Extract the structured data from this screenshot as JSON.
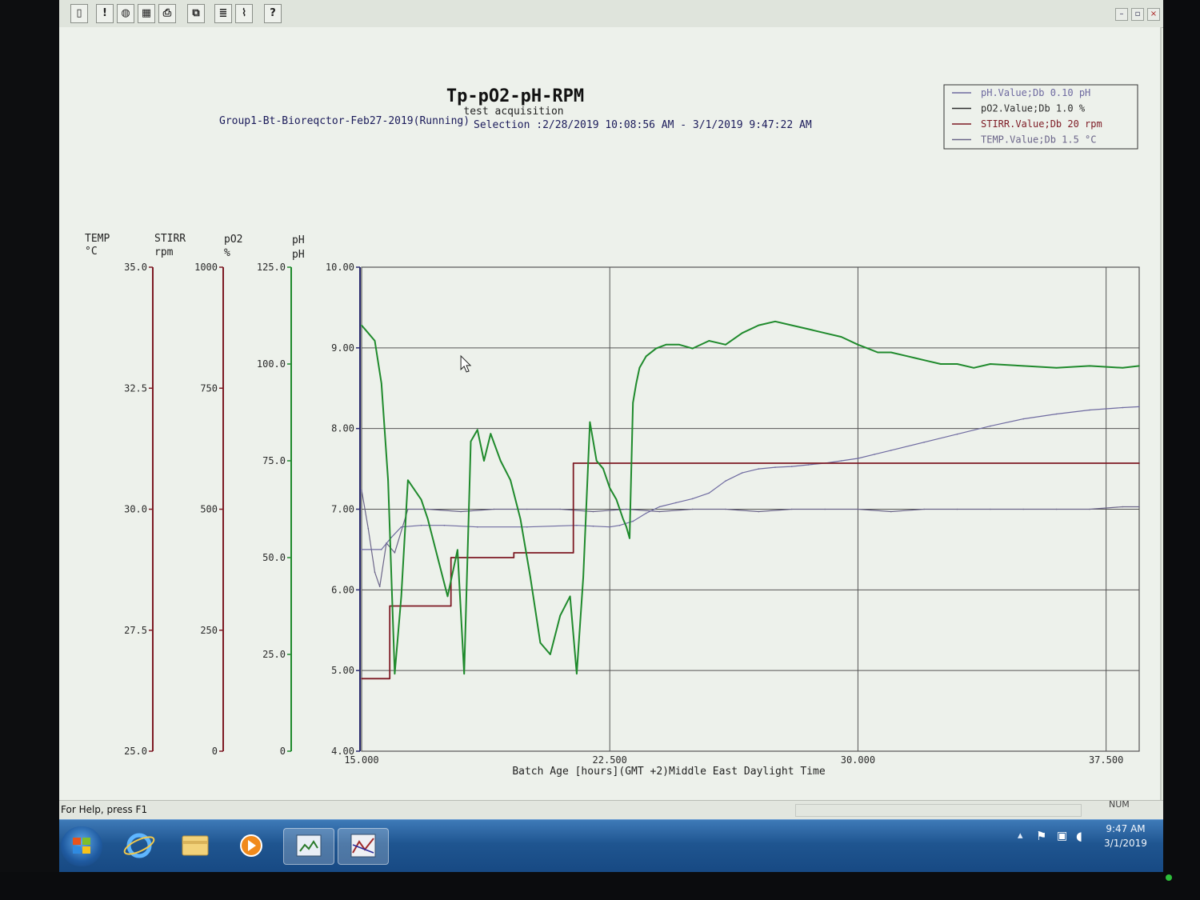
{
  "toolbar": {
    "buttons": [
      "new-document-icon",
      "alert-icon",
      "globe-icon",
      "grid-icon",
      "print-icon",
      "copy-icon",
      "list-icon",
      "trend-icon",
      "help-icon"
    ],
    "help_label": "?"
  },
  "window_controls": {
    "minimize": "–",
    "maximize": "▫",
    "close": "×"
  },
  "chart": {
    "title": "Tp-pO2-pH-RPM",
    "subtitle": "test acquisition",
    "source": "Group1-Bt-Bioreqctor-Feb27-2019(Running)",
    "selection": "Selection :2/28/2019 10:08:56 AM - 3/1/2019 9:47:22 AM",
    "xlabel": "Batch Age [hours](GMT +2)Middle East Daylight Time"
  },
  "legend": [
    {
      "label": "pH.Value;Db 0.10 pH",
      "color": "#6e6aa0"
    },
    {
      "label": "pO2.Value;Db 1.0 %",
      "color": "#2d2d2d"
    },
    {
      "label": "STIRR.Value;Db 20 rpm",
      "color": "#7d1a24"
    },
    {
      "label": "TEMP.Value;Db 1.5 °C",
      "color": "#6a6488"
    }
  ],
  "axes": {
    "temp": {
      "name": "TEMP",
      "unit": "°C",
      "color": "#7d1a24",
      "ticks": [
        "35.0",
        "32.5",
        "30.0",
        "27.5",
        "25.0"
      ]
    },
    "stirr": {
      "name": "STIRR",
      "unit": "rpm",
      "color": "#7d1a24",
      "ticks": [
        "1000",
        "750",
        "500",
        "250",
        "0"
      ]
    },
    "po2": {
      "name": "pO2",
      "unit": "%",
      "color": "#1f8a2c",
      "ticks": [
        "125.0",
        "100.0",
        "75.0",
        "50.0",
        "25.0",
        "0"
      ]
    },
    "ph": {
      "name": "pH",
      "unit": "pH",
      "color": "#2a2a6e",
      "ticks": [
        "10.00",
        "9.00",
        "8.00",
        "7.00",
        "6.00",
        "5.00",
        "4.00"
      ]
    },
    "x": {
      "ticks": [
        "15.000",
        "22.500",
        "30.000",
        "37.500"
      ]
    }
  },
  "chart_data": {
    "type": "line",
    "title": "Tp-pO2-pH-RPM",
    "xlabel": "Batch Age [hours](GMT +2)Middle East Daylight Time",
    "xlim": [
      15,
      38.5
    ],
    "series": [
      {
        "name": "pH.Value;Db 0.10 pH",
        "axis": "ph",
        "ylim": [
          4,
          10
        ],
        "color": "#6e6aa0",
        "x": [
          15.0,
          15.6,
          15.9,
          16.2,
          16.8,
          17.5,
          18.5,
          20.0,
          21.5,
          22.0,
          22.5,
          22.8,
          23.2,
          23.6,
          24.0,
          24.5,
          25.0,
          25.5,
          26.0,
          26.5,
          27.0,
          27.5,
          28.0,
          28.5,
          29.0,
          29.5,
          30.0,
          30.5,
          31.0,
          32.0,
          33.0,
          34.0,
          35.0,
          36.0,
          37.0,
          38.0,
          38.5
        ],
        "y": [
          6.5,
          6.5,
          6.65,
          6.78,
          6.8,
          6.8,
          6.78,
          6.78,
          6.8,
          6.79,
          6.78,
          6.8,
          6.85,
          6.95,
          7.03,
          7.08,
          7.13,
          7.2,
          7.35,
          7.45,
          7.5,
          7.52,
          7.53,
          7.55,
          7.57,
          7.6,
          7.63,
          7.68,
          7.73,
          7.83,
          7.93,
          8.03,
          8.12,
          8.18,
          8.23,
          8.26,
          8.27
        ]
      },
      {
        "name": "pO2.Value;Db 1.0 %",
        "axis": "po2",
        "ylim": [
          0,
          125
        ],
        "color": "#1f8a2c",
        "x": [
          15.0,
          15.2,
          15.4,
          15.6,
          15.8,
          16.0,
          16.2,
          16.4,
          16.8,
          17.0,
          17.3,
          17.6,
          17.9,
          18.1,
          18.3,
          18.5,
          18.7,
          18.9,
          19.2,
          19.5,
          19.8,
          20.1,
          20.4,
          20.7,
          21.0,
          21.3,
          21.5,
          21.7,
          21.9,
          22.1,
          22.3,
          22.5,
          22.7,
          22.9,
          23.0,
          23.1,
          23.2,
          23.3,
          23.4,
          23.6,
          23.9,
          24.2,
          24.6,
          25.0,
          25.5,
          26.0,
          26.5,
          27.0,
          27.5,
          28.0,
          28.5,
          29.0,
          29.5,
          30.0,
          30.3,
          30.6,
          31.0,
          31.5,
          32.0,
          32.5,
          33.0,
          33.5,
          34.0,
          35.0,
          36.0,
          37.0,
          38.0,
          38.5
        ],
        "y": [
          110,
          108,
          106,
          95,
          70,
          20,
          40,
          70,
          65,
          60,
          50,
          40,
          52,
          20,
          80,
          83,
          75,
          82,
          75,
          70,
          60,
          45,
          28,
          25,
          35,
          40,
          20,
          45,
          85,
          75,
          73,
          68,
          65,
          60,
          58,
          55,
          90,
          95,
          99,
          102,
          104,
          105,
          105,
          104,
          106,
          105,
          108,
          110,
          111,
          110,
          109,
          108,
          107,
          105,
          104,
          103,
          103,
          102,
          101,
          100,
          100,
          99,
          100,
          99.5,
          99,
          99.5,
          99,
          99.5
        ]
      },
      {
        "name": "STIRR.Value;Db 20 rpm",
        "axis": "stirr",
        "ylim": [
          0,
          1000
        ],
        "color": "#7d1a24",
        "x": [
          15.0,
          15.85,
          15.85,
          17.7,
          17.7,
          19.6,
          19.6,
          21.4,
          21.4,
          38.5
        ],
        "y": [
          150,
          150,
          300,
          300,
          400,
          400,
          410,
          410,
          595,
          595
        ]
      },
      {
        "name": "TEMP.Value;Db 1.5 °C",
        "axis": "temp",
        "ylim": [
          25,
          35
        ],
        "color": "#6a6488",
        "x": [
          15.0,
          15.2,
          15.4,
          15.55,
          15.75,
          16.0,
          16.4,
          17.0,
          18.0,
          19.0,
          20.0,
          21.0,
          22.0,
          23.0,
          24.0,
          25.0,
          26.0,
          27.0,
          28.0,
          29.0,
          30.0,
          31.0,
          32.0,
          33.0,
          34.0,
          35.0,
          36.0,
          37.0,
          38.0,
          38.5
        ],
        "y": [
          30.4,
          29.6,
          28.7,
          28.4,
          29.3,
          29.1,
          30.0,
          30.0,
          29.95,
          30.0,
          30.0,
          30.0,
          29.95,
          30.0,
          29.95,
          30.0,
          30.0,
          29.95,
          30.0,
          30.0,
          30.0,
          29.95,
          30.0,
          30.0,
          30.0,
          30.0,
          30.0,
          30.0,
          30.05,
          30.05
        ]
      }
    ]
  },
  "cursor": {
    "x_hours": 18.0,
    "ph_value": 8.9
  },
  "status": {
    "help": "For Help, press F1",
    "num": "NUM"
  },
  "taskbar": {
    "apps": [
      "start-orb",
      "internet-explorer-icon",
      "file-explorer-icon",
      "media-player-icon",
      "application-window-icon",
      "plot-application-icon"
    ],
    "time": "9:47 AM",
    "date": "3/1/2019",
    "tray": [
      "show-hidden-icons",
      "flag-icon",
      "network-icon",
      "speaker-icon"
    ]
  }
}
